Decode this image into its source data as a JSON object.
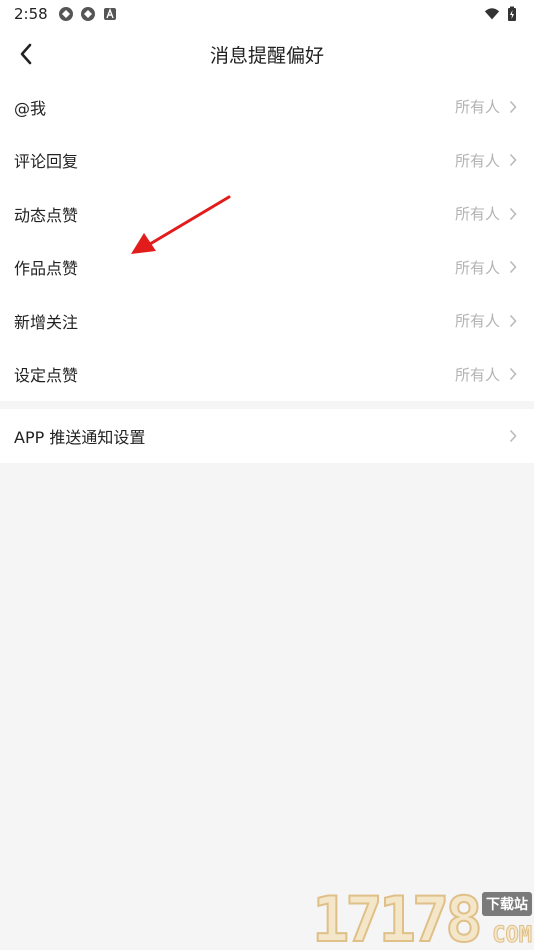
{
  "status_bar": {
    "time": "2:58"
  },
  "header": {
    "title": "消息提醒偏好"
  },
  "settings": {
    "rows": [
      {
        "label": "@我",
        "value": "所有人"
      },
      {
        "label": "评论回复",
        "value": "所有人"
      },
      {
        "label": "动态点赞",
        "value": "所有人"
      },
      {
        "label": "作品点赞",
        "value": "所有人"
      },
      {
        "label": "新增关注",
        "value": "所有人"
      },
      {
        "label": "设定点赞",
        "value": "所有人"
      }
    ]
  },
  "push": {
    "label": "APP 推送通知设置"
  },
  "watermark": {
    "number": "17178",
    "badge": "下载站",
    "suffix": "COM"
  },
  "colors": {
    "annotation_arrow": "#e21b1b",
    "secondary_text": "#b3b3b3"
  }
}
